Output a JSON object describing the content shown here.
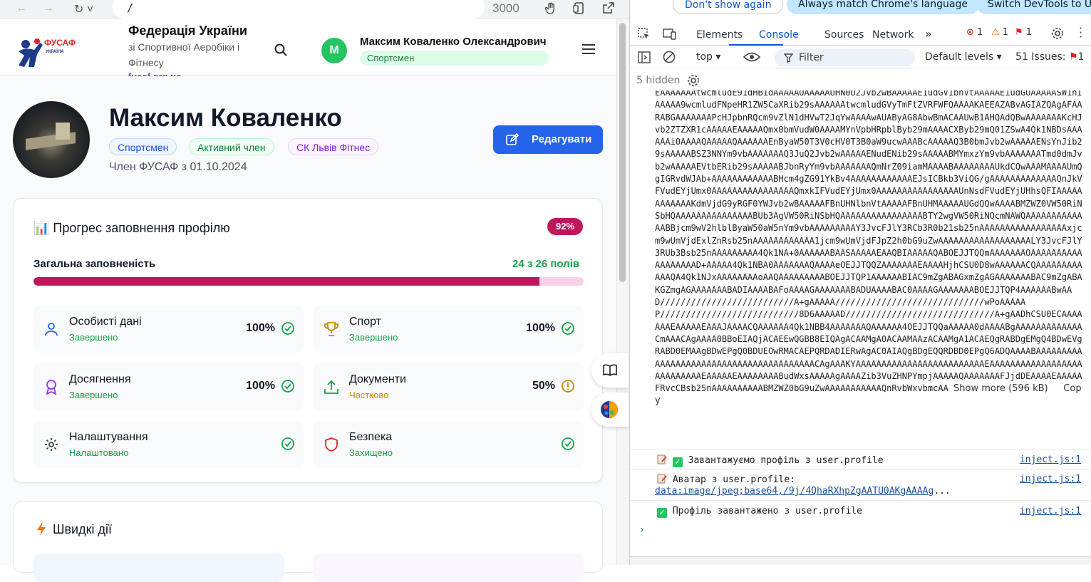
{
  "browser": {
    "url": "/",
    "port": "3000"
  },
  "header": {
    "org_title": "Федерація України",
    "org_subtitle": "зі Спортивної Аеробіки і Фітнесу",
    "org_link": "fusaf.org.ua",
    "logo_text": "ФУСАФ",
    "avatar_letter": "М",
    "user_name": "Максим Коваленко Олександрович",
    "user_role": "Спортсмен"
  },
  "profile": {
    "name": "Максим Коваленко",
    "badges": [
      "Спортсмен",
      "Активний член",
      "СК Львів Фітнес"
    ],
    "member_since": "Член ФУСАФ з 01.10.2024",
    "edit_label": "Редагувати"
  },
  "progress": {
    "title": "📊 Прогрес заповнення профілю",
    "percent_label": "92%",
    "overall_label": "Загальна заповненість",
    "count_label": "24 з 26 полів",
    "fill_fraction": 0.92,
    "sections": [
      {
        "title": "Особисті дані",
        "status": "Завершено",
        "percent": "100%",
        "state": "ok"
      },
      {
        "title": "Спорт",
        "status": "Завершено",
        "percent": "100%",
        "state": "ok"
      },
      {
        "title": "Досягнення",
        "status": "Завершено",
        "percent": "100%",
        "state": "ok"
      },
      {
        "title": "Документи",
        "status": "Частково",
        "percent": "50%",
        "state": "warn"
      },
      {
        "title": "Налаштування",
        "status": "Налаштовано",
        "percent": "",
        "state": "ok"
      },
      {
        "title": "Безпека",
        "status": "Захищено",
        "percent": "",
        "state": "ok"
      }
    ]
  },
  "quick_actions": {
    "title": "Швидкі дії"
  },
  "colors": {
    "accent": "#be185d",
    "primary": "#2563eb",
    "success": "#16a34a",
    "warning": "#ca8a04"
  },
  "devtools": {
    "infobar": [
      "Don't show again",
      "Always match Chrome's language",
      "Switch DevTools to U"
    ],
    "tabs": [
      "Elements",
      "Console",
      "Sources",
      "Network"
    ],
    "counts": {
      "errors": "1",
      "warnings": "1",
      "issues_badge": "1"
    },
    "context": "top",
    "filter_placeholder": "Filter",
    "levels": "Default levels",
    "issues": "51 Issues:",
    "issues_count": "1",
    "hidden": "5 hidden",
    "base64_text": "EAAAAAAAtwcmludE91dHB1dAAAAAOAAAAAUHN0U2Jvb2wBAAAAAE1udGV1bnVtAAAAAE1udGUAAAAASW1nIAAAAA9wcmludFNpeHR1ZW5CaXRib29sAAAAAAtwcmludGVyTmFtZVRFWFQAAAAKAEEAZABvAGIAZQAgAFAARABGAAAAAAAPcHJpbnRQcm9vZlN1dHVwT2JqYwAAAAwAUAByAG8AbwBmACAAUwB1AHQAdQBwAAAAAAAKcHJvb2ZTZXR1cAAAAAEAAAAAQmx0bmVudW0AAAAMYnVpbHRpblByb29mAAAACXByb29mQ01ZSwA4Qk1NBDsAAAAAAi0AAAAQAAAAAQAAAAAAEnByaW50T3V0cHV0T3B0aW9ucwAAABcAAAAAQ3B0bmJvb2wAAAAAENsYnJib29sAAAAABSZ3NNYm9vbAAAAAAAQ3JuQ2Jvb2wAAAAAENudENib29sAAAAABMYmxzYm9vbAAAAAAATmd0dmJvb2wAAAAAEVtbERib29sAAAAABJbnRyYm9vbAAAAAAAQmNrZ09iamMAAAABAAAAAAAAUkdCQwAAAMAAAAUmQgIGRvdWJAb+AAAAAAAAAAAABHcm4gZG91YkBv4AAAAAAAAAAAAEJsICBkb3ViQG/gAAAAAAAAAAAAAQnJkVFVudEYjUmx0AAAAAAAAAAAAAAAAQmxkIFVudEYjUmx0AAAAAAAAAAAAAAAAUnNsdFVudEYjUHhsQFIAAAAAAAAAAAAKdmVjdG9yRGF0YWJvb2wBAAAAAFBnUHNlbnVtAAAAAFBnUHMAAAAAUGdQQwAAAABMZWZ0VW50RiNSbHQAAAAAAAAAAAAAAABUb3AgVW50RiNSbHQAAAAAAAAAAAAAAAABTY2wgVW50RiNQcmNAWQAAAAAAAAAAAAABBjcm9wV2hlblByaW50aW5nYm9vbAAAAAAAAAY3JvcFJlY3RCb3R0b21sb25nAAAAAAAAAAAAAAAAAxjcm9wUmVjdExlZnRsb25nAAAAAAAAAAAA1jcm9wUmVjdFJpZ2h0bG9uZwAAAAAAAAAAAAAAAAAALY3JvcFJlY3RUb3Bsb25nAAAAAAAAA4Qk1NA+0AAAAAABAASAAAAAEAAQBIAAAAAQABOEJJTQQmAAAAAAAOAAAAAAAAAAAAAAAAAAD+AAAAA4Qk1NBA0AAAAAAAQAAAAeOEJJTQQZAAAAAAAEAAAAHjhCSU0D8wAAAAAACQAAAAAAAAAAAAQA4Qk1NJxAAAAAAAAoAAQAAAAAAAAABOEJJTQP1AAAAAABIAC9mZgABAGxmZgAGAAAAAAABAC9mZgABAKGZmgAGAAAAAAABADIAAAABAFoAAAAGAAAAAAABADUAAAABAC0AAAAGAAAAAAABOEJJTQP4AAAAAABwAAD//////////////////////////A+gAAAAA/////////////////////////////wPoAAAAAP///////////////////////////8D6AAAAAD/////////////////////////////A+gAADhCSU0ECAAAAAAAEAAAAAEAAAJAAAACQAAAAAA4Qk1NBB4AAAAAAAQAAAAAA4OEJJTQQaAAAAA0dAAAABgAAAAAAAAAAAAACmAAACAgAAAA0BBoEIAQjACAEEwQGBB8EIQAgACAAMgA0ACAAMAAzACAAMgA1ACAEQgRABDgEMgQ4BDwEVgRABD0EMAAgBDwEPgQ0BDUEOwRMACAEPQRDADIERwAgAC0AIAQgBDgEQQRDBD0EPgQ6ADQAAAABAAAAAAAAAAAAAAAAAAAAAAAAAAAAAAAAAAAAAAAACAgAAAKYAAAAAAAAAAAAAAAAAAAAAAAAAEAAAAAAAAAAAAAAAAAAAAAAAAAAAEAAAAAEAAAAAAAABudWxsAAAAAgAAAAZib3VuZHNPYmpjAAAAAQAAAAAAAFJjdDEAAAAEAAAAAFRvcCBsb25nAAAAAAAAAABMZWZ0bG9uZwAAAAAAAAAAAQnRvbWxvbmcAA",
    "show_more": "Show more (596 kB)",
    "copy": "Copy",
    "logs": [
      {
        "text": "Завантажуємо профіль з user.profile",
        "source": "inject.js:1"
      },
      {
        "text": "Аватар з user.profile:",
        "link": "data:image/jpeg;base64,/9j/4QhaRXhpZgAATU0AKgAAAAg",
        "ellipsis": "...",
        "source": "inject.js:1"
      },
      {
        "text": "Профіль завантажено з user.profile",
        "source": "inject.js:1"
      }
    ]
  }
}
